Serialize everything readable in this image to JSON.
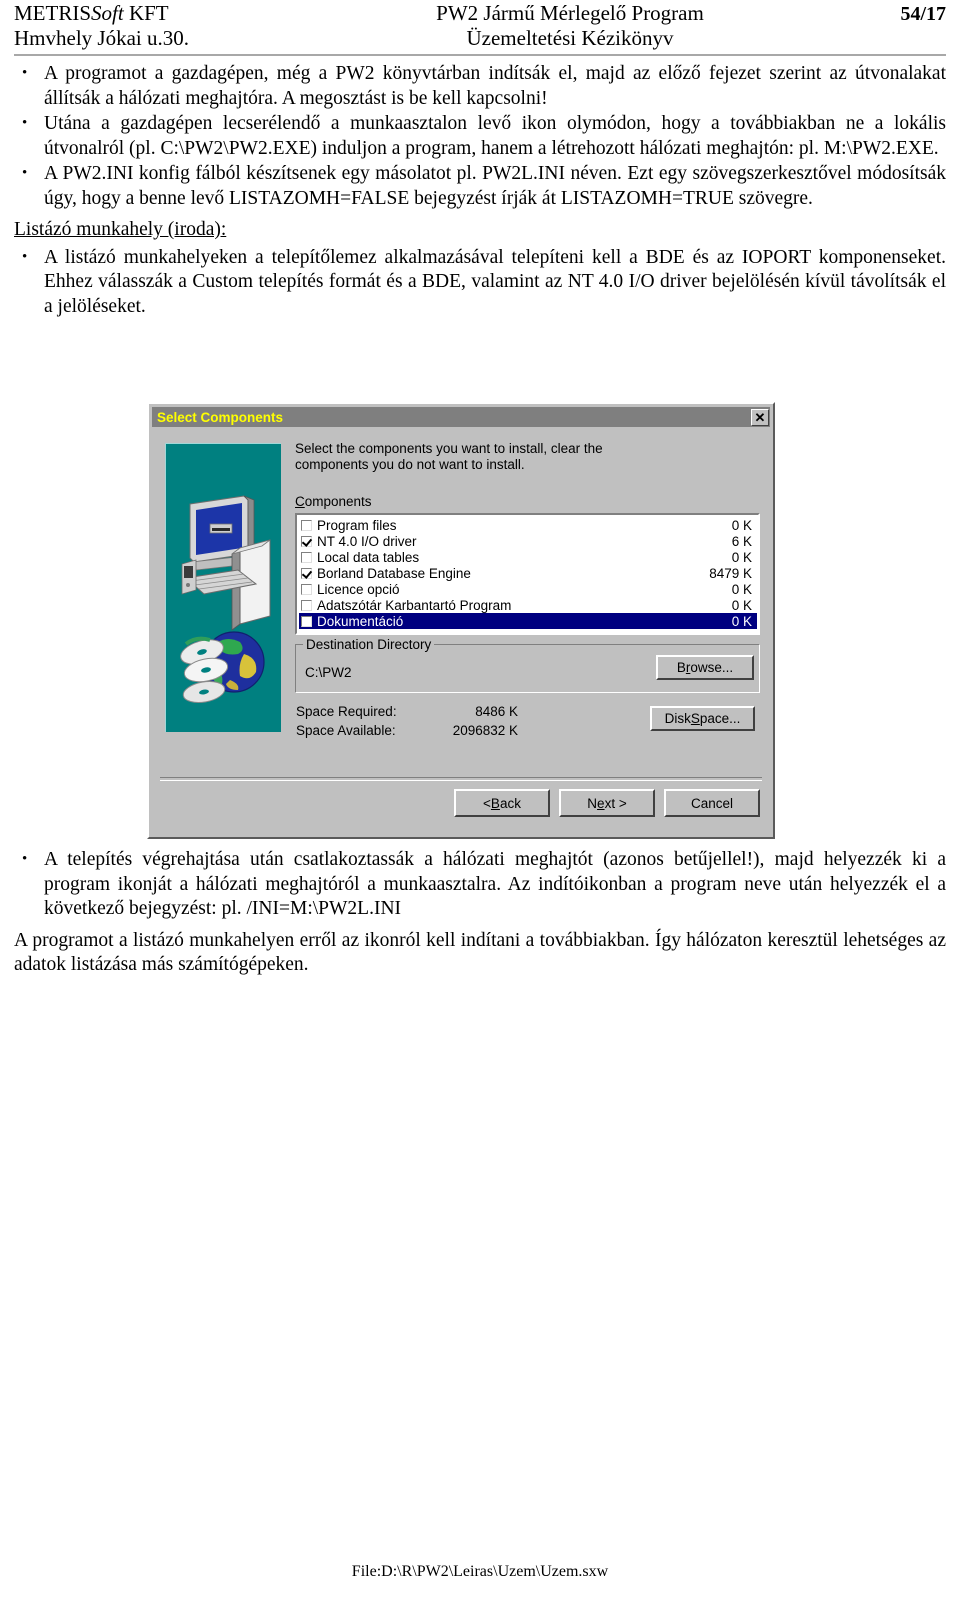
{
  "header": {
    "company_line1_a": "METRIS",
    "company_line1_b": "Soft",
    "company_line1_c": " KFT",
    "company_line2": "Hmvhely Jókai u.30.",
    "title_line1": "PW2 Jármű Mérlegelő Program",
    "title_line2": "Üzemeltetési Kézikönyv",
    "page_number": "54/17"
  },
  "body": {
    "bullet1": "A programot a gazdagépen, még a PW2 könyvtárban indítsák el, majd az előző fejezet szerint az útvonalakat állítsák a hálózati meghajtóra. A megosztást is be kell kapcsolni!",
    "bullet2": "Utána a gazdagépen lecserélendő a munkaasztalon levő ikon olymódon, hogy a továbbiakban ne a lokális útvonalról (pl. C:\\PW2\\PW2.EXE) induljon a program, hanem a létrehozott hálózati meghajtón: pl. M:\\PW2.EXE.",
    "bullet3": "A PW2.INI konfig fálból készítsenek egy másolatot pl. PW2L.INI néven. Ezt egy szövegszerkesztővel módosítsák úgy, hogy a benne levő LISTAZOMH=FALSE bejegyzést írják át   LISTAZOMH=TRUE szövegre.",
    "subheading": "Listázó munkahely (iroda):",
    "bullet4": "A listázó munkahelyeken a telepítőlemez alkalmazásával telepíteni kell a BDE és az IOPORT komponenseket. Ehhez válasszák a Custom telepítés formát és a BDE, valamint az NT 4.0 I/O driver bejelölésén kívül távolítsák el a jelöléseket.",
    "bullet5": "A telepítés végrehajtása után csatlakoztassák a hálózati meghajtót (azonos betűjellel!), majd helyezzék ki a program ikonját a hálózati meghajtóról a munkaasztalra. Az indítóikonban a program neve után helyezzék el a következő bejegyzést: pl. /INI=M:\\PW2L.INI",
    "closing_para": "A programot a listázó munkahelyen erről az ikonról kell indítani a továbbiakban. Így hálózaton keresztül lehetséges az adatok listázása más számítógépeken."
  },
  "dialog": {
    "title": "Select Components",
    "close_glyph": "✕",
    "intro": "Select the components you want to install, clear the components you do not want to install.",
    "components_label_accel": "C",
    "components_label_rest": "omponents",
    "components": [
      {
        "label": "Program files",
        "size": "0 K",
        "checked": false,
        "selected": false
      },
      {
        "label": "NT 4.0 I/O driver",
        "size": "6 K",
        "checked": true,
        "selected": false
      },
      {
        "label": "Local data tables",
        "size": "0 K",
        "checked": false,
        "selected": false
      },
      {
        "label": "Borland Database Engine",
        "size": "8479 K",
        "checked": true,
        "selected": false
      },
      {
        "label": "Licence opció",
        "size": "0 K",
        "checked": false,
        "selected": false
      },
      {
        "label": "Adatszótár Karbantartó Program",
        "size": "0 K",
        "checked": false,
        "selected": false
      },
      {
        "label": "Dokumentáció",
        "size": "0 K",
        "checked": false,
        "selected": true
      }
    ],
    "destination_legend": "Destination Directory",
    "destination_value": "C:\\PW2",
    "browse_pre": "B",
    "browse_accel": "r",
    "browse_post": "owse...",
    "space_required_label": "Space Required:",
    "space_required_value": "8486 K",
    "space_available_label": "Space Available:",
    "space_available_value": "2096832 K",
    "disk_space_pre": "Disk ",
    "disk_space_accel": "S",
    "disk_space_post": "pace...",
    "back_pre": "< ",
    "back_accel": "B",
    "back_post": "ack",
    "next_pre": "N",
    "next_accel": "e",
    "next_post": "xt >",
    "cancel_label": "Cancel",
    "colors": {
      "face": "#c0c0c0",
      "titlebar": "#7f7f7f",
      "title_text": "#ffff00",
      "illustration_bg": "#008080",
      "selection": "#000080"
    }
  },
  "footer": {
    "path": "File:D:\\R\\PW2\\Leiras\\Uzem\\Uzem.sxw"
  }
}
